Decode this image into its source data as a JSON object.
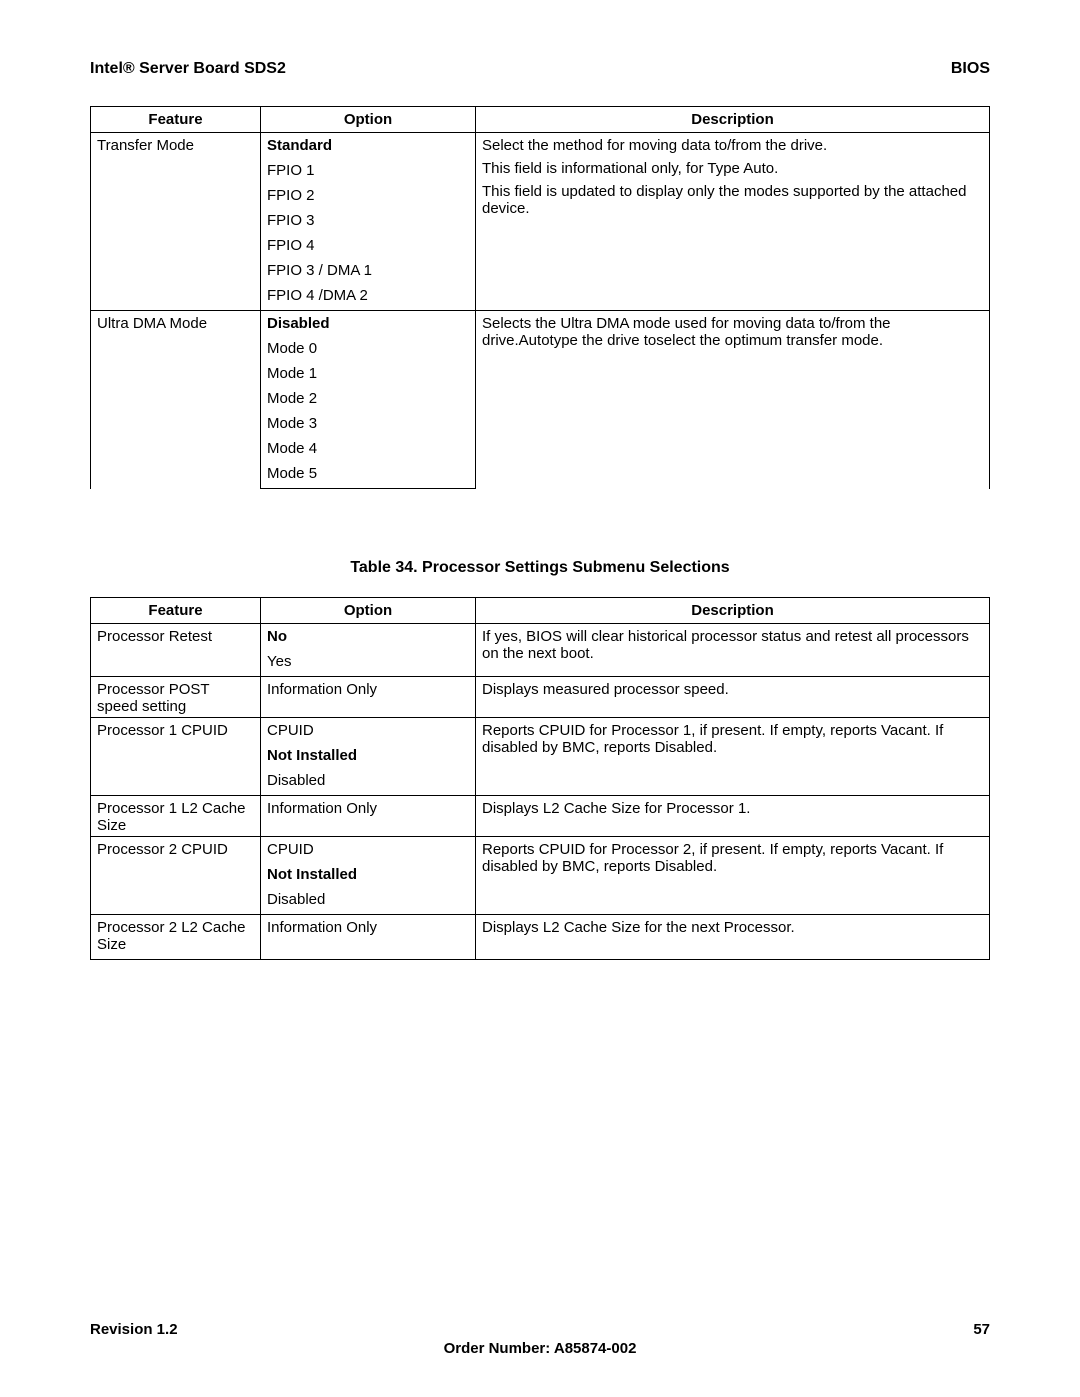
{
  "header": {
    "left": "Intel® Server Board SDS2",
    "right": "BIOS"
  },
  "table1": {
    "headers": {
      "feature": "Feature",
      "option": "Option",
      "description": "Description"
    },
    "rows": [
      {
        "feature": "Transfer Mode",
        "options": [
          {
            "text": "Standard",
            "bold": true
          },
          {
            "text": "FPIO 1"
          },
          {
            "text": "FPIO 2"
          },
          {
            "text": "FPIO 3"
          },
          {
            "text": "FPIO 4"
          },
          {
            "text": "FPIO 3 / DMA 1"
          },
          {
            "text": "FPIO 4 /DMA 2"
          }
        ],
        "desc_lines": [
          "Select the method for moving data to/from the drive.",
          "This field is informational only, for Type Auto.",
          "This field is updated to display only the modes supported by the attached device."
        ]
      },
      {
        "feature": "Ultra DMA Mode",
        "options": [
          {
            "text": "Disabled",
            "bold": true
          },
          {
            "text": "Mode 0"
          },
          {
            "text": "Mode 1"
          },
          {
            "text": "Mode 2"
          },
          {
            "text": "Mode 3"
          },
          {
            "text": "Mode 4"
          },
          {
            "text": "Mode 5"
          }
        ],
        "desc_lines": [
          "Selects the Ultra DMA  mode used for moving data to/from the drive.Autotype the drive toselect the optimum transfer mode."
        ]
      }
    ]
  },
  "caption": "Table 34. Processor Settings Submenu Selections",
  "table2": {
    "headers": {
      "feature": "Feature",
      "option": "Option",
      "description": "Description"
    },
    "rows": [
      {
        "feature": "Processor Retest",
        "options": [
          {
            "text": "No",
            "bold": true
          },
          {
            "text": "Yes"
          }
        ],
        "desc_lines": [
          "If yes, BIOS will clear historical processor status and retest all processors on the next boot."
        ]
      },
      {
        "feature": "Processor POST speed setting",
        "options": [
          {
            "text": "Information Only"
          }
        ],
        "desc_lines": [
          "Displays measured processor speed."
        ]
      },
      {
        "feature": "Processor 1 CPUID",
        "options": [
          {
            "text": "CPUID"
          },
          {
            "text": "Not Installed",
            "bold": true
          },
          {
            "text": "Disabled"
          }
        ],
        "desc_lines": [
          "Reports CPUID for Processor 1, if present.  If empty, reports Vacant.  If disabled by BMC, reports Disabled."
        ]
      },
      {
        "feature": "Processor 1 L2 Cache Size",
        "options": [
          {
            "text": "Information Only"
          }
        ],
        "desc_lines": [
          "Displays L2 Cache Size for Processor 1."
        ]
      },
      {
        "feature": "Processor 2 CPUID",
        "options": [
          {
            "text": "CPUID"
          },
          {
            "text": "Not Installed",
            "bold": true
          },
          {
            "text": "Disabled"
          }
        ],
        "desc_lines": [
          "Reports CPUID for Processor 2, if present.  If empty, reports Vacant.  If disabled by BMC, reports Disabled."
        ]
      },
      {
        "feature": "Processor 2 L2 Cache Size",
        "options": [
          {
            "text": "Information Only"
          }
        ],
        "desc_lines": [
          "Displays L2 Cache Size for the next Processor."
        ]
      }
    ]
  },
  "footer": {
    "revision": "Revision 1.2",
    "pagenum": "57",
    "order": "Order Number:  A85874-002"
  }
}
